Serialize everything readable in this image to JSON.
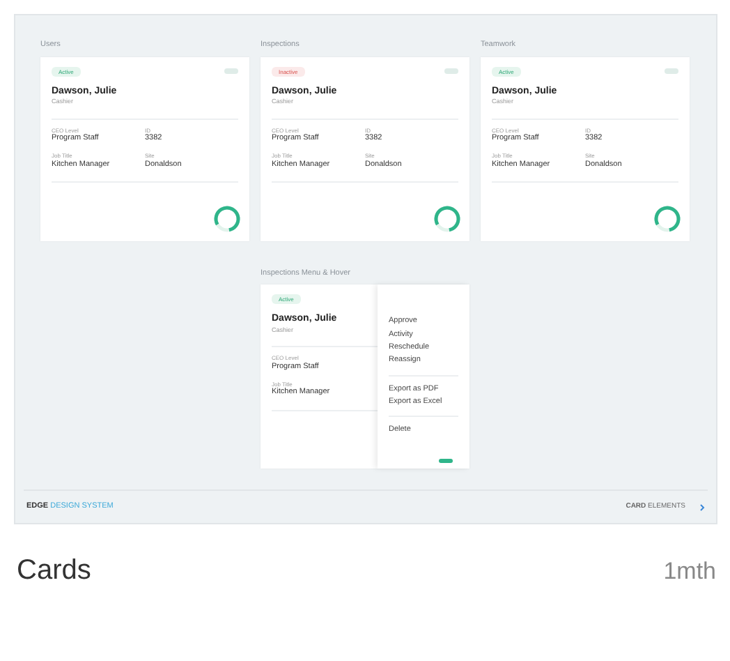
{
  "sections": [
    {
      "title": "Users",
      "card": {
        "status": {
          "label": "Active",
          "kind": "active"
        },
        "name": "Dawson, Julie",
        "role": "Cashier",
        "fields": [
          {
            "label": "CEO Level",
            "value": "Program Staff"
          },
          {
            "label": "ID",
            "value": "3382"
          },
          {
            "label": "Job Title",
            "value": "Kitchen Manager"
          },
          {
            "label": "Site",
            "value": "Donaldson"
          }
        ]
      }
    },
    {
      "title": "Inspections",
      "card": {
        "status": {
          "label": "Inactive",
          "kind": "inactive"
        },
        "name": "Dawson, Julie",
        "role": "Cashier",
        "fields": [
          {
            "label": "CEO Level",
            "value": "Program Staff"
          },
          {
            "label": "ID",
            "value": "3382"
          },
          {
            "label": "Job Title",
            "value": "Kitchen Manager"
          },
          {
            "label": "Site",
            "value": "Donaldson"
          }
        ]
      }
    },
    {
      "title": "Teamwork",
      "card": {
        "status": {
          "label": "Active",
          "kind": "active"
        },
        "name": "Dawson, Julie",
        "role": "Cashier",
        "fields": [
          {
            "label": "CEO Level",
            "value": "Program Staff"
          },
          {
            "label": "ID",
            "value": "3382"
          },
          {
            "label": "Job Title",
            "value": "Kitchen Manager"
          },
          {
            "label": "Site",
            "value": "Donaldson"
          }
        ]
      }
    },
    {
      "title": "Inspections Menu & Hover",
      "card": {
        "status": {
          "label": "Active",
          "kind": "active"
        },
        "name": "Dawson, Julie",
        "role": "Cashier",
        "fields": [
          {
            "label": "CEO Level",
            "value": "Program Staff"
          },
          {
            "label": "Job Title",
            "value": "Kitchen Manager"
          }
        ],
        "menu": [
          [
            "Approve",
            "Activity",
            "Reschedule",
            "Reassign"
          ],
          [
            "Export as PDF",
            "Export as Excel"
          ],
          [
            "Delete"
          ]
        ]
      }
    }
  ],
  "footer": {
    "brand": "EDGE",
    "brand_suffix": "DESIGN SYSTEM",
    "section_bold": "CARD",
    "section_rest": "ELEMENTS"
  },
  "caption": {
    "title": "Cards",
    "age": "1mth"
  }
}
